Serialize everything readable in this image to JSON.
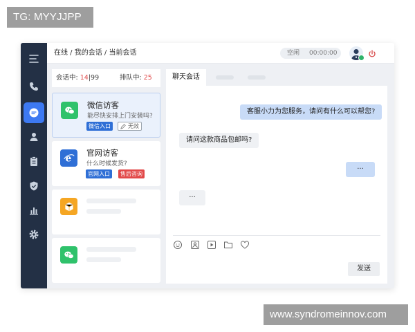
{
  "watermarks": {
    "top": "TG: MYYJJPP",
    "bottom": "www.syndromeinnov.com"
  },
  "sidebar": {
    "icons": [
      "menu-icon",
      "phone-icon",
      "chat-icon",
      "user-icon",
      "clipboard-icon",
      "shield-icon",
      "bar-chart-icon",
      "gear-icon"
    ],
    "active_index": 2,
    "accent": "#3d79f2",
    "background": "#233045"
  },
  "topbar": {
    "breadcrumb": "在线 / 我的会话 / 当前会话",
    "status_label": "空闲",
    "timer": "00:00:00"
  },
  "list": {
    "in_session_label": "会话中:",
    "in_session_count": "14",
    "in_session_sep": "|",
    "in_session_max": "99",
    "queue_label": "排队中:",
    "queue_count": "25",
    "cards": [
      {
        "title": "微信访客",
        "subtitle": "能尽快安排上门安装吗?",
        "badges": [
          "微信入口",
          "无效"
        ],
        "selected": true
      },
      {
        "title": "官网访客",
        "subtitle": "什么时候发货?",
        "badges": [
          "官网入口",
          "售后咨询"
        ],
        "selected": false
      }
    ]
  },
  "chat": {
    "tab_label": "聊天会话",
    "messages": [
      {
        "from": "agent",
        "text": "客服小力为您服务，请问有什么可以帮您?"
      },
      {
        "from": "visitor",
        "text": "请问这款商品包邮吗?"
      },
      {
        "from": "agent",
        "text": "···"
      },
      {
        "from": "visitor",
        "text": "···"
      }
    ],
    "toolbar_icons": [
      "emoji-icon",
      "image-icon",
      "video-icon",
      "folder-icon",
      "heart-icon"
    ],
    "send_label": "发送"
  }
}
